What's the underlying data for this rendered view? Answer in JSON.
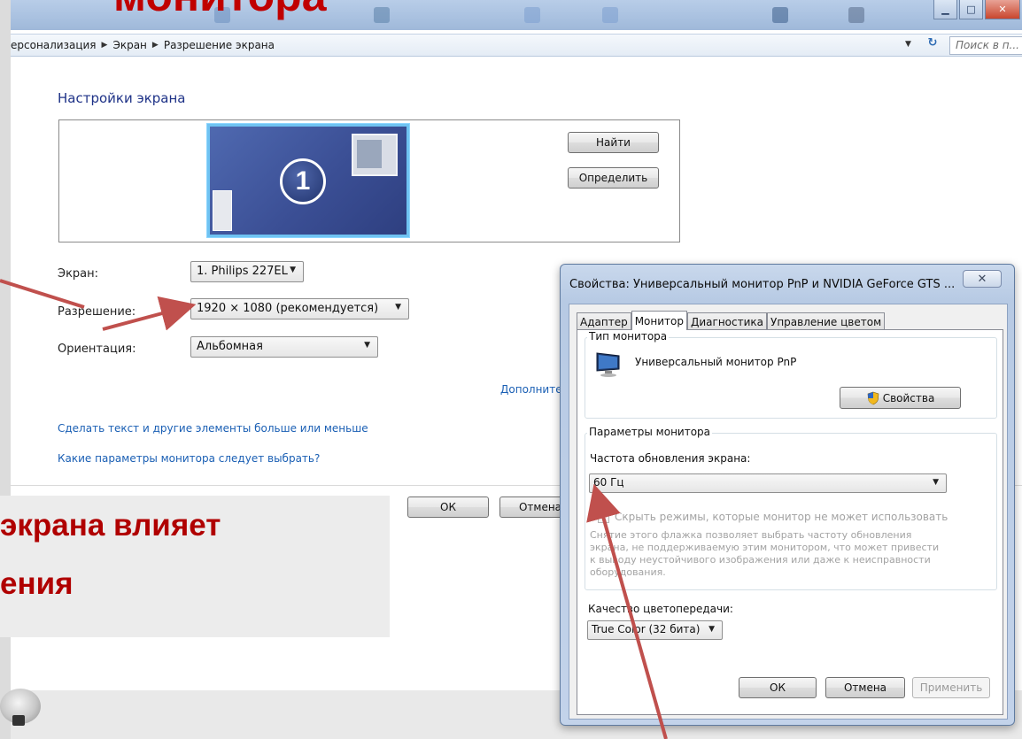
{
  "slide": {
    "title_fragment": "монитора",
    "body_line1": "экрана влияет",
    "body_line2": "ения"
  },
  "window": {
    "breadcrumb": [
      "ерсонализация",
      "Экран",
      "Разрешение экрана"
    ],
    "search_placeholder": "Поиск в п...",
    "page_title": "Настройки экрана",
    "preview": {
      "monitor_number": "1"
    },
    "buttons": {
      "find": "Найти",
      "identify": "Определить",
      "ok": "ОК",
      "cancel": "Отмена"
    },
    "fields": {
      "screen_label": "Экран:",
      "screen_value": "1. Philips 227EL",
      "resolution_label": "Разрешение:",
      "resolution_value": "1920 × 1080 (рекомендуется)",
      "orientation_label": "Ориентация:",
      "orientation_value": "Альбомная"
    },
    "links": {
      "advanced": "Дополнительные параметры",
      "text_size": "Сделать текст и другие элементы больше или меньше",
      "which_settings": "Какие параметры монитора следует выбрать?"
    }
  },
  "dialog": {
    "title": "Свойства: Универсальный монитор PnP и NVIDIA GeForce GTS ...",
    "close_glyph": "✕",
    "tabs": [
      "Адаптер",
      "Монитор",
      "Диагностика",
      "Управление цветом"
    ],
    "active_tab": "Монитор",
    "monitor_type": {
      "legend": "Тип монитора",
      "name": "Универсальный монитор PnP",
      "properties_button": "Свойства"
    },
    "monitor_settings": {
      "legend": "Параметры монитора",
      "refresh_label": "Частота обновления экрана:",
      "refresh_value": "60 Гц",
      "hide_modes_label": "Скрыть режимы, которые монитор не может использовать",
      "help_lines": [
        "Снятие этого флажка позволяет выбрать частоту обновления",
        "экрана, не поддерживаемую этим монитором, что может привести",
        "к выводу неустойчивого изображения или даже к неисправности",
        "оборудования."
      ]
    },
    "color": {
      "label": "Качество цветопередачи:",
      "value": "True Color (32 бита)"
    },
    "buttons": {
      "ok": "ОК",
      "cancel": "Отмена",
      "apply": "Применить"
    }
  },
  "colors": {
    "slide_text": "#b00000",
    "link": "#1a5fb4",
    "annotation_arrow": "#c0504d"
  }
}
